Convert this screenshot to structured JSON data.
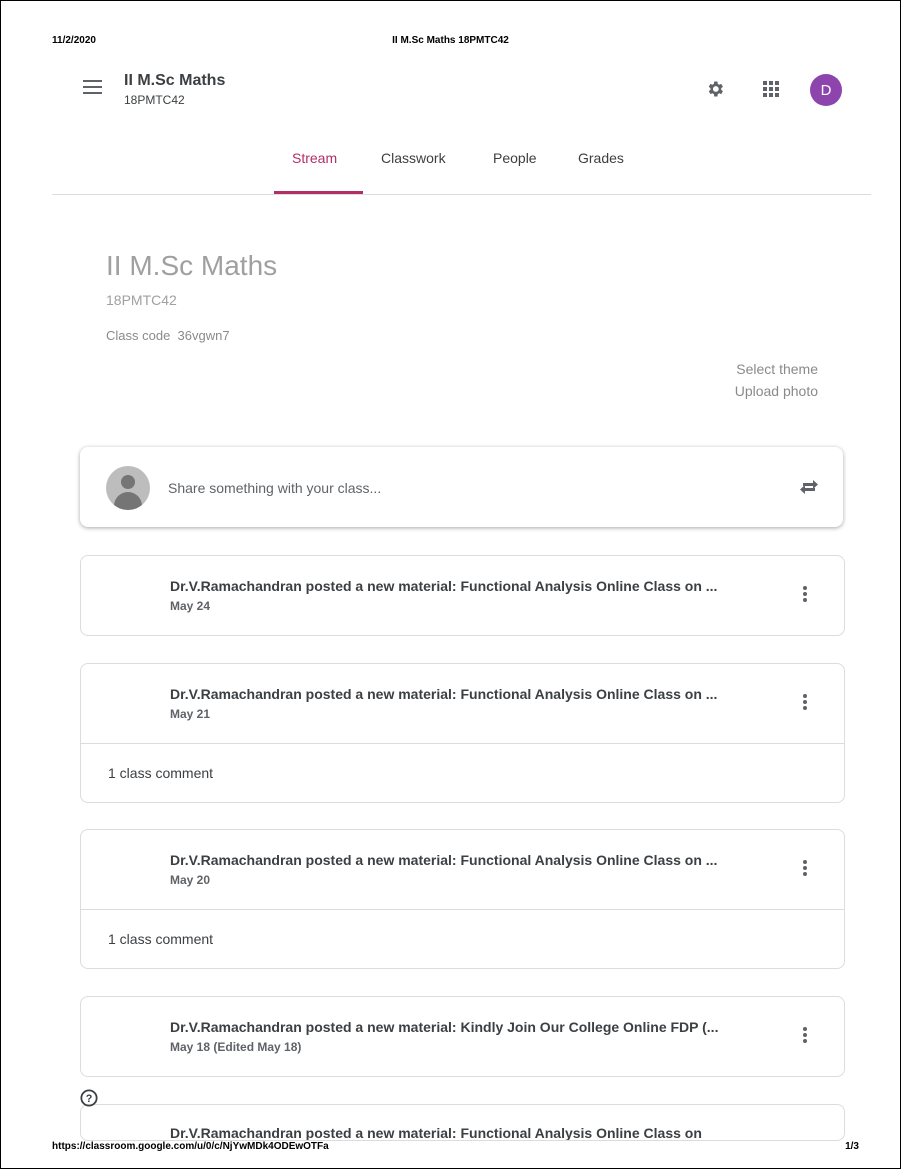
{
  "print": {
    "date": "11/2/2020",
    "title": "II M.Sc Maths 18PMTC42",
    "url": "https://classroom.google.com/u/0/c/NjYwMDk4ODEwOTFa",
    "page": "1/3"
  },
  "header": {
    "class_name": "II M.Sc Maths",
    "class_section": "18PMTC42",
    "avatar_letter": "D",
    "avatar_color": "#8e44ad"
  },
  "tabs": [
    {
      "label": "Stream",
      "active": true
    },
    {
      "label": "Classwork",
      "active": false
    },
    {
      "label": "People",
      "active": false
    },
    {
      "label": "Grades",
      "active": false
    }
  ],
  "accent_color": "#b32e67",
  "banner": {
    "title": "II M.Sc Maths",
    "section": "18PMTC42",
    "class_code_label": "Class code",
    "class_code": "36vgwn7",
    "select_theme": "Select theme",
    "upload_photo": "Upload photo"
  },
  "share": {
    "placeholder": "Share something with your class..."
  },
  "posts": [
    {
      "title": "Dr.V.Ramachandran posted a new material: Functional Analysis Online Class on ...",
      "date": "May 24",
      "comments": ""
    },
    {
      "title": "Dr.V.Ramachandran posted a new material: Functional Analysis Online Class on ...",
      "date": "May 21",
      "comments": "1 class comment"
    },
    {
      "title": "Dr.V.Ramachandran posted a new material: Functional Analysis Online Class on ...",
      "date": "May 20",
      "comments": "1 class comment"
    },
    {
      "title": "Dr.V.Ramachandran posted a new material: Kindly Join Our College Online FDP (...",
      "date": "May 18 (Edited May 18)",
      "comments": ""
    },
    {
      "title": "Dr.V.Ramachandran posted a new material: Functional Analysis Online Class on",
      "date": "",
      "comments": ""
    }
  ]
}
